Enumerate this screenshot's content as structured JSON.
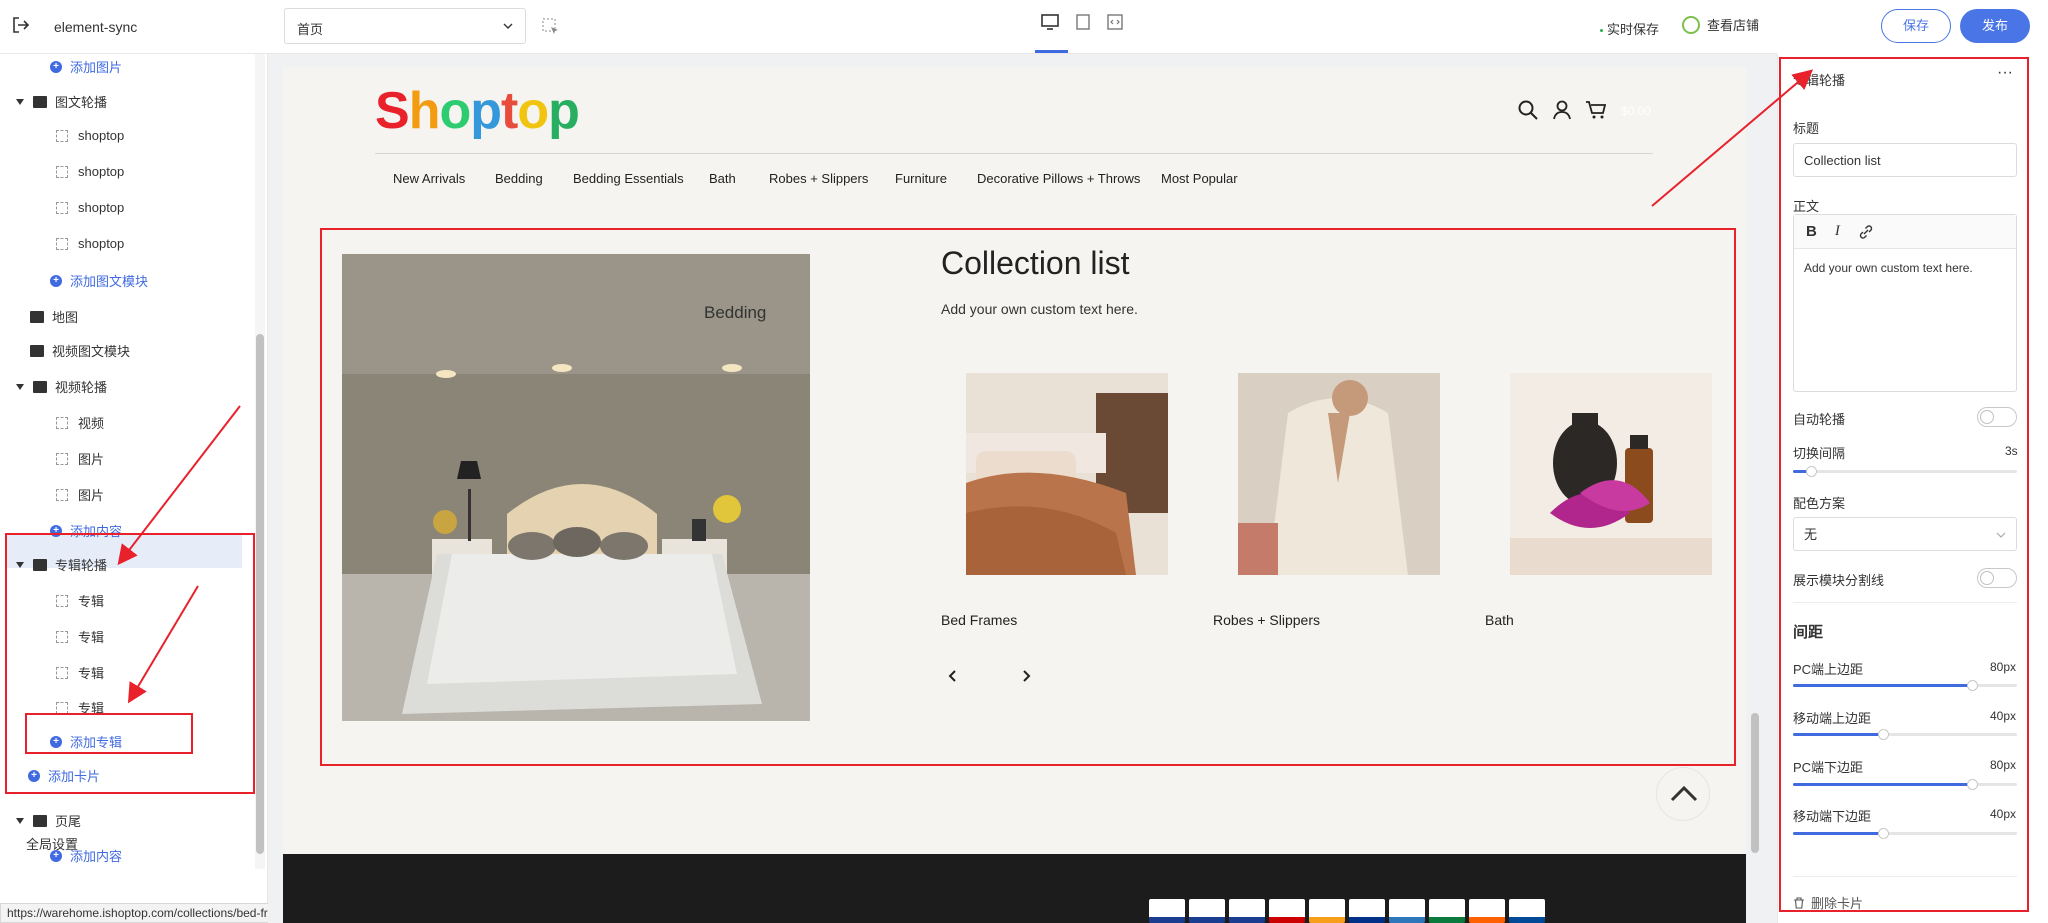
{
  "topbar": {
    "app_name": "element-sync",
    "page_select": "首页",
    "realtime_save": "实时保存",
    "view_store": "查看店铺",
    "save": "保存",
    "publish": "发布"
  },
  "sidebar": {
    "items": [
      {
        "label": "添加图片",
        "type": "add"
      },
      {
        "label": "图文轮播",
        "type": "group"
      },
      {
        "label": "shoptop",
        "type": "child"
      },
      {
        "label": "shoptop",
        "type": "child"
      },
      {
        "label": "shoptop",
        "type": "child"
      },
      {
        "label": "shoptop",
        "type": "child"
      },
      {
        "label": "添加图文模块",
        "type": "add"
      },
      {
        "label": "地图",
        "type": "section"
      },
      {
        "label": "视频图文模块",
        "type": "section"
      },
      {
        "label": "视频轮播",
        "type": "group"
      },
      {
        "label": "视频",
        "type": "child"
      },
      {
        "label": "图片",
        "type": "child"
      },
      {
        "label": "图片",
        "type": "child"
      },
      {
        "label": "添加内容",
        "type": "add"
      },
      {
        "label": "专辑轮播",
        "type": "group"
      },
      {
        "label": "专辑",
        "type": "child"
      },
      {
        "label": "专辑",
        "type": "child"
      },
      {
        "label": "专辑",
        "type": "child"
      },
      {
        "label": "专辑",
        "type": "child"
      },
      {
        "label": "添加专辑",
        "type": "add"
      },
      {
        "label": "添加卡片",
        "type": "add"
      },
      {
        "label": "页尾",
        "type": "group"
      },
      {
        "label": "添加内容",
        "type": "add"
      }
    ],
    "global_settings": "全局设置",
    "status_url": "https://warehome.ishoptop.com/collections/bed-frames"
  },
  "store": {
    "logo": "Shoptop",
    "cart_amount": "$0.00",
    "nav": [
      "New Arrivals",
      "Bedding",
      "Bedding Essentials",
      "Bath",
      "Robes + Slippers",
      "Furniture",
      "Decorative Pillows + Throws",
      "Most Popular"
    ],
    "featured_label": "Bedding",
    "collection_title": "Collection list",
    "collection_text": "Add your own custom text here.",
    "cards": [
      "Bed Frames",
      "Robes + Slippers",
      "Bath"
    ],
    "payment_icons": [
      "visa",
      "visa",
      "visa",
      "maestro",
      "mastercard",
      "paypal",
      "amex",
      "jcb",
      "discover",
      "diners"
    ]
  },
  "panel": {
    "title": "专辑轮播",
    "title_label": "标题",
    "title_value": "Collection list",
    "body_label": "正文",
    "body_value": "Add your own custom text here.",
    "autoplay_label": "自动轮播",
    "interval_label": "切换间隔",
    "interval_value": "3s",
    "interval_level": 0.08,
    "color_label": "配色方案",
    "color_value": "无",
    "divider_label": "展示模块分割线",
    "spacing_heading": "间距",
    "pc_top_label": "PC端上边距",
    "pc_top_value": "80px",
    "pc_top_level": 0.8,
    "mobile_top_label": "移动端上边距",
    "mobile_top_value": "40px",
    "mobile_top_level": 0.4,
    "pc_bottom_label": "PC端下边距",
    "pc_bottom_value": "80px",
    "pc_bottom_level": 0.8,
    "mobile_bottom_label": "移动端下边距",
    "mobile_bottom_value": "40px",
    "mobile_bottom_level": 0.4,
    "delete_card": "删除卡片"
  },
  "colors": {
    "accent": "#3f6ae0",
    "annotation_red": "#e8212b",
    "footer_bg": "#1c1c1c"
  }
}
